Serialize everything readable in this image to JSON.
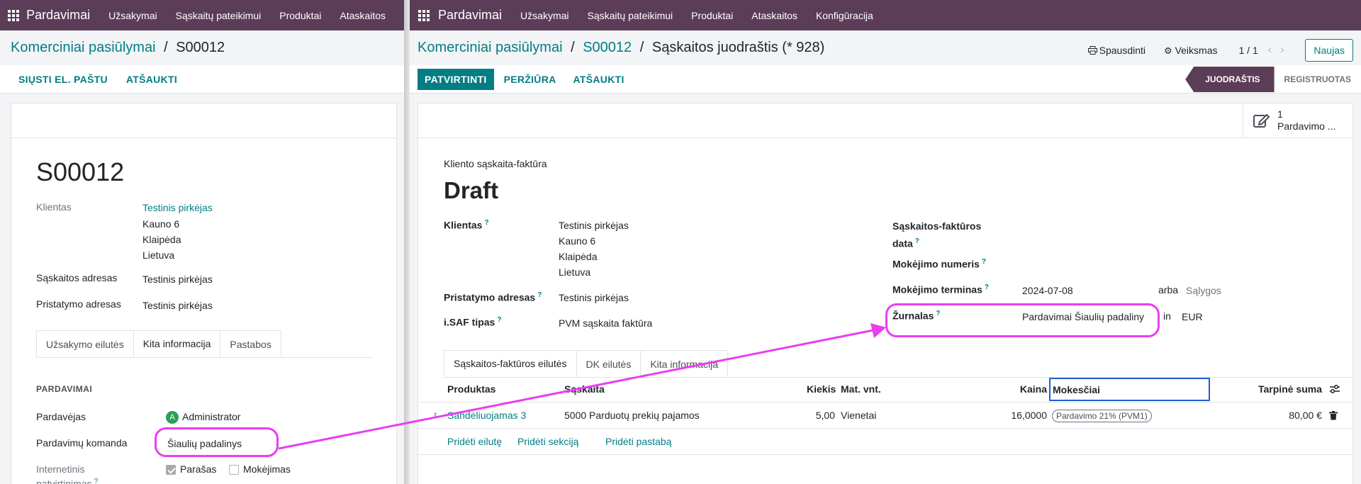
{
  "topbar": {
    "brand": "Pardavimai",
    "menu_left": [
      "Užsakymai",
      "Sąskaitų pateikimui",
      "Produktai",
      "Ataskaitos"
    ],
    "menu_right": [
      "Užsakymai",
      "Sąskaitų pateikimui",
      "Produktai",
      "Ataskaitos",
      "Konfigūracija"
    ]
  },
  "left": {
    "breadcrumb": {
      "parent": "Komerciniai pasiūlymai",
      "sep": "/",
      "current": "S00012"
    },
    "actions": [
      "SIŲSTI EL. PAŠTU",
      "ATŠAUKTI"
    ],
    "title": "S00012",
    "fields": {
      "client_label": "Klientas",
      "client_name": "Testinis pirkėjas",
      "client_addr": [
        "Kauno 6",
        "Klaipėda",
        "Lietuva"
      ],
      "invoice_addr_label": "Sąskaitos adresas",
      "invoice_addr_value": "Testinis pirkėjas",
      "delivery_addr_label": "Pristatymo adresas",
      "delivery_addr_value": "Testinis pirkėjas"
    },
    "tabs": [
      "Užsakymo eilutės",
      "Kita informacija",
      "Pastabos"
    ],
    "section": "PARDAVIMAI",
    "sales": {
      "seller_label": "Pardavėjas",
      "seller_avatar": "A",
      "seller_value": "Administrator",
      "team_label": "Pardavimų komanda",
      "team_value": "Šiaulių padalinys",
      "online_label": "Internetinis patvirtinimas",
      "signature_label": "Parašas",
      "payment_label": "Mokėjimas"
    }
  },
  "right": {
    "breadcrumb": {
      "p1": "Komerciniai pasiūlymai",
      "p2": "S00012",
      "current": "Sąskaitos juodraštis (* 928)",
      "sep": "/"
    },
    "print": "Spausdinti",
    "action": "Veiksmas",
    "pager": "1 / 1",
    "new_button": "Naujas",
    "actions": {
      "primary": "PATVIRTINTI",
      "others": [
        "PERŽIŪRA",
        "ATŠAUKTI"
      ]
    },
    "status": {
      "current": "JUODRAŠTIS",
      "next": "REGISTRUOTAS"
    },
    "smart": {
      "count": "1",
      "label": "Pardavimo ..."
    },
    "doc_type": "Kliento sąskaita-faktūra",
    "title": "Draft",
    "left_fields": {
      "client_label": "Klientas",
      "client_name": "Testinis pirkėjas",
      "client_addr": [
        "Kauno 6",
        "Klaipėda",
        "Lietuva"
      ],
      "delivery_label": "Pristatymo adresas",
      "delivery_value": "Testinis pirkėjas",
      "isaf_label": "i.SAF tipas",
      "isaf_value": "PVM sąskaita faktūra"
    },
    "right_fields": {
      "invoice_date_label_1": "Sąskaitos-faktūros",
      "invoice_date_label_2": "data",
      "payment_ref_label": "Mokėjimo numeris",
      "payment_term_label": "Mokėjimo terminas",
      "payment_term_date": "2024-07-08",
      "or": "arba",
      "terms": "Sąlygos",
      "journal_label": "Žurnalas",
      "journal_value": "Pardavimai Šiaulių padaliny",
      "in": "in",
      "currency": "EUR"
    },
    "tabs": [
      "Sąskaitos-faktūros eilutės",
      "DK eilutės",
      "Kita informacija"
    ],
    "table": {
      "headers": {
        "product": "Produktas",
        "account": "Sąskaita",
        "qty": "Kiekis",
        "uom": "Mat. vnt.",
        "price": "Kaina",
        "taxes": "Mokesčiai",
        "subtotal": "Tarpinė suma"
      },
      "row": {
        "product": "Sandėliuojamas 3",
        "account": "5000 Parduotų prekių pajamos",
        "qty": "5,00",
        "uom": "Vienetai",
        "price": "16,0000",
        "tax": "Pardavimo 21% (PVM1)",
        "subtotal": "80,00 €"
      },
      "add_links": [
        "Pridėti eilutę",
        "Pridėti sekciją",
        "Pridėti pastabą"
      ]
    }
  },
  "colors": {
    "topbar": "#5b3d57",
    "accent": "#017e84",
    "highlight": "#ea3ef1"
  }
}
